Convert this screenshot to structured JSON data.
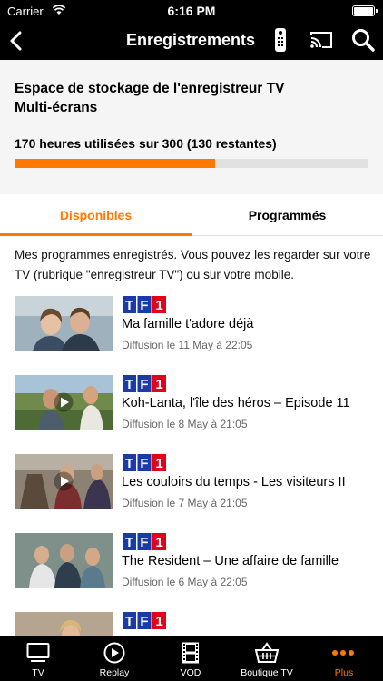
{
  "status_bar": {
    "carrier": "Carrier",
    "time": "6:16 PM"
  },
  "nav": {
    "title": "Enregistrements",
    "icons": [
      "back-icon",
      "remote-icon",
      "cast-icon",
      "search-icon"
    ]
  },
  "storage": {
    "title": "Espace de stockage de l'enregistreur TV Multi-écrans",
    "usage": "170 heures utilisées sur 300 (130 restantes)",
    "used_fraction": 0.567,
    "accent_color": "#ff7900"
  },
  "tabs": [
    {
      "label": "Disponibles",
      "active": true
    },
    {
      "label": "Programmés",
      "active": false
    }
  ],
  "intro": "Mes programmes enregistrés. Vous pouvez les regarder sur votre TV (rubrique \"enregistreur TV\")  ou sur votre mobile.",
  "recordings": [
    {
      "channel": "TF1",
      "title": "Ma famille t'adore déjà",
      "date": "Diffusion le 11 May à 22:05",
      "play": false
    },
    {
      "channel": "TF1",
      "title": "Koh-Lanta, l'île des héros – Episode 11",
      "date": "Diffusion le 8 May à 21:05",
      "play": true
    },
    {
      "channel": "TF1",
      "title": "Les couloirs du temps - Les visiteurs II",
      "date": "Diffusion le 7 May à 21:05",
      "play": true
    },
    {
      "channel": "TF1",
      "title": "The Resident – Une affaire de famille",
      "date": "Diffusion le 6 May à 22:05",
      "play": false
    },
    {
      "channel": "TF1",
      "title": "",
      "date": "",
      "play": false
    }
  ],
  "tabbar": [
    {
      "label": "TV",
      "icon": "tv-icon",
      "active": false
    },
    {
      "label": "Replay",
      "icon": "replay-icon",
      "active": false
    },
    {
      "label": "VOD",
      "icon": "film-icon",
      "active": false
    },
    {
      "label": "Boutique TV",
      "icon": "basket-icon",
      "active": false
    },
    {
      "label": "Plus",
      "icon": "more-icon",
      "active": true
    }
  ]
}
